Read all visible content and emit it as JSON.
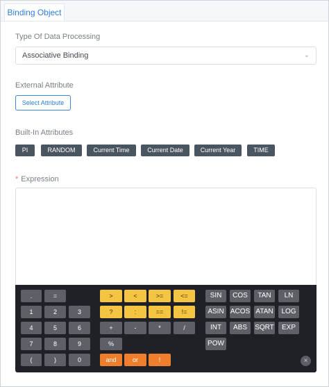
{
  "tab": {
    "label": "Binding Object"
  },
  "processing": {
    "label": "Type Of Data Processing",
    "selected": "Associative Binding"
  },
  "external": {
    "label": "External Attribute",
    "button": "Select Attribute"
  },
  "builtin": {
    "label": "Built-In Attributes",
    "chips": [
      "PI",
      "RANDOM",
      "Current Time",
      "Current Date",
      "Current Year",
      "TIME"
    ]
  },
  "expression": {
    "required_mark": "*",
    "label": "Expression"
  },
  "calculator": {
    "digits": {
      "dot": ".",
      "equals": "=",
      "d1": "1",
      "d2": "2",
      "d3": "3",
      "d4": "4",
      "d5": "5",
      "d6": "6",
      "d7": "7",
      "d8": "8",
      "d9": "9",
      "lparen": "(",
      "rparen": ")",
      "d0": "0"
    },
    "operators": {
      "gt": ">",
      "lt": "<",
      "gte": ">=",
      "lte": "<=",
      "question": "?",
      "colon": ":",
      "eq": "==",
      "neq": "!=",
      "plus": "+",
      "minus": "-",
      "times": "*",
      "divide": "/",
      "percent": "%",
      "and": "and",
      "or": "or",
      "not": "!"
    },
    "functions": {
      "sin": "SIN",
      "cos": "COS",
      "tan": "TAN",
      "ln": "LN",
      "asin": "ASIN",
      "acos": "ACOS",
      "atan": "ATAN",
      "log": "LOG",
      "int": "INT",
      "abs": "ABS",
      "sqrt": "SQRT",
      "exp": "EXP",
      "pow": "POW"
    },
    "close_glyph": "×"
  },
  "colors": {
    "accent": "#2f7fd7",
    "chip": "#4a5562",
    "calc_bg": "#1f2126",
    "key_grey": "#5d6167",
    "key_yellow": "#f5c443",
    "key_orange": "#ef7f2d"
  }
}
